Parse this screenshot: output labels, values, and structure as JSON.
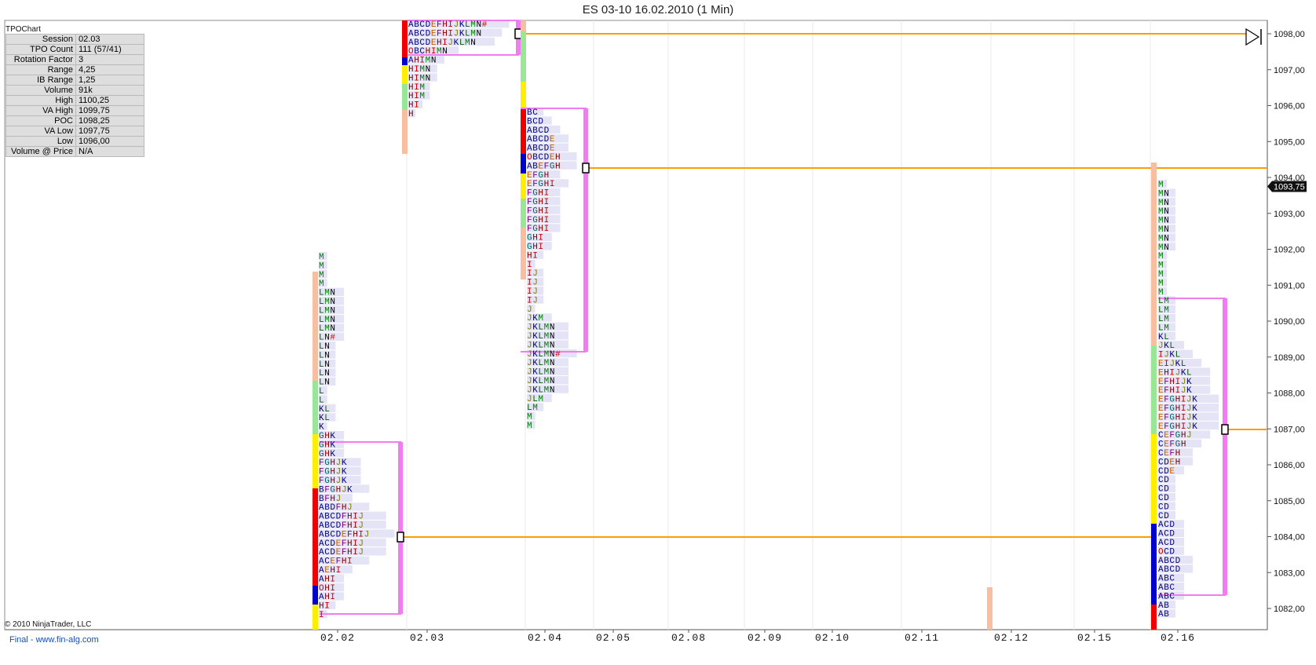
{
  "window": {
    "title": "ES 03-10  16.02.2010 (1 Min)"
  },
  "stats": {
    "title": "TPOChart",
    "rows": [
      {
        "label": "Session",
        "value": "02.03"
      },
      {
        "label": "TPO Count",
        "value": "111 (57/41)"
      },
      {
        "label": "Rotation Factor",
        "value": "3"
      },
      {
        "label": "Range",
        "value": "4,25"
      },
      {
        "label": "IB Range",
        "value": "1,25"
      },
      {
        "label": "Volume",
        "value": "91k"
      },
      {
        "label": "High",
        "value": "1100,25"
      },
      {
        "label": "VA High",
        "value": "1099,75"
      },
      {
        "label": "POC",
        "value": "1098,25"
      },
      {
        "label": "VA Low",
        "value": "1097,75"
      },
      {
        "label": "Low",
        "value": "1096,00"
      },
      {
        "label": "Volume @ Price",
        "value": "N/A"
      }
    ]
  },
  "footer": {
    "copyright": "© 2010 NinjaTrader, LLC",
    "link": "Final - www.fin-alg.com"
  },
  "colors": {
    "va_box": "#f07cf0",
    "poc_line": "#ff9c00",
    "ib_red": "#ee0000",
    "ib_blue": "#0000cc",
    "yellow": "#ffee00",
    "green": "#99e699",
    "salmon": "#f8bea2",
    "volume": "#e4e4f6"
  },
  "chart_data": {
    "type": "tpo-profile",
    "y_axis": {
      "ticks": [
        "1098,00",
        "1097,00",
        "1096,00",
        "1095,00",
        "1094,00",
        "1093,00",
        "1092,00",
        "1091,00",
        "1090,00",
        "1089,00",
        "1088,00",
        "1087,00",
        "1086,00",
        "1085,00",
        "1084,00",
        "1083,00",
        "1082,00"
      ],
      "current_price": "1093,75"
    },
    "x_axis": {
      "labels": [
        "02.02",
        "02.03",
        "02.04",
        "02.05",
        "02.08",
        "02.09",
        "02.10",
        "02.11",
        "02.12",
        "02.15",
        "02.16"
      ]
    },
    "sessions": [
      {
        "label": "02.02",
        "poc": "1084,25",
        "rows": [
          "M",
          "M",
          "M",
          "M",
          "LMN",
          "LMN",
          "LMN",
          "LMN",
          "LMN",
          "LN#",
          "LN",
          "LN",
          "LN",
          "LN",
          "LN",
          "L",
          "L",
          "KL",
          "KL",
          "K",
          "GHK",
          "GHK",
          "GHK",
          "FGHJK",
          "FGHJK",
          "FGHJK",
          "BFGHJK",
          "BFHJ",
          "ABDFHJ",
          "ABCDFHIJ",
          "ABCDFHIJ",
          "ABCDEFHIJ",
          "ACDEFHIJ",
          "ACDEFHIJ",
          "ACEFHI",
          "AEHI",
          "AHI",
          "OHI",
          "AHI",
          "HI",
          "I"
        ]
      },
      {
        "label": "02.03",
        "poc": "1098,25",
        "rows": [
          "ABCDEFHIJKLMN#",
          "ABCDEFHIJKLMN",
          "ABCDEHIJKLMN",
          "OBCHIMN",
          "AHIMN",
          "HIMN",
          "HIMN",
          "HIM",
          "HIM",
          "HI",
          "H"
        ]
      },
      {
        "label": "02.04",
        "poc": "1094,50",
        "rows": [
          "BC",
          "BCD",
          "ABCD",
          "ABCDE",
          "ABCDE",
          "OBCDEH",
          "ABEFGH",
          "EFGH",
          "EFGHI",
          "FGHI",
          "FGHI",
          "FGHI",
          "FGHI",
          "FGHI",
          "GHI",
          "GHI",
          "HI",
          "I",
          "IJ",
          "IJ",
          "IJ",
          "IJ",
          "J",
          "JKM",
          "JKLMN",
          "JKLMN",
          "JKLMN",
          "JKLMN#",
          "JKLMN",
          "JKLMN",
          "JKLMN",
          "JKLMN",
          "JLM",
          "LM",
          "M",
          "M"
        ]
      },
      {
        "label": "02.16",
        "poc": "1087,25",
        "rows": [
          "M",
          "MN",
          "MN",
          "MN",
          "MN",
          "MN",
          "MN",
          "MN",
          "M",
          "M",
          "M",
          "M",
          "M",
          "LM",
          "LM",
          "LM",
          "LM",
          "KL",
          "JKL",
          "IJKL",
          "EIJKL",
          "EHIJKL",
          "EFHIJK",
          "EFHIJK",
          "EFGHIJK",
          "EFGHIJK",
          "EFGHIJK",
          "EFGHIJK",
          "CEFGHJ",
          "CEFGH",
          "CEFH",
          "CDEH",
          "CDE",
          "CD",
          "CD",
          "CD",
          "CD",
          "CD",
          "ACD",
          "ACD",
          "ACD",
          "OCD",
          "ABCD",
          "ABCD",
          "ABC",
          "ABC",
          "ABC",
          "AB",
          "AB"
        ]
      }
    ]
  }
}
